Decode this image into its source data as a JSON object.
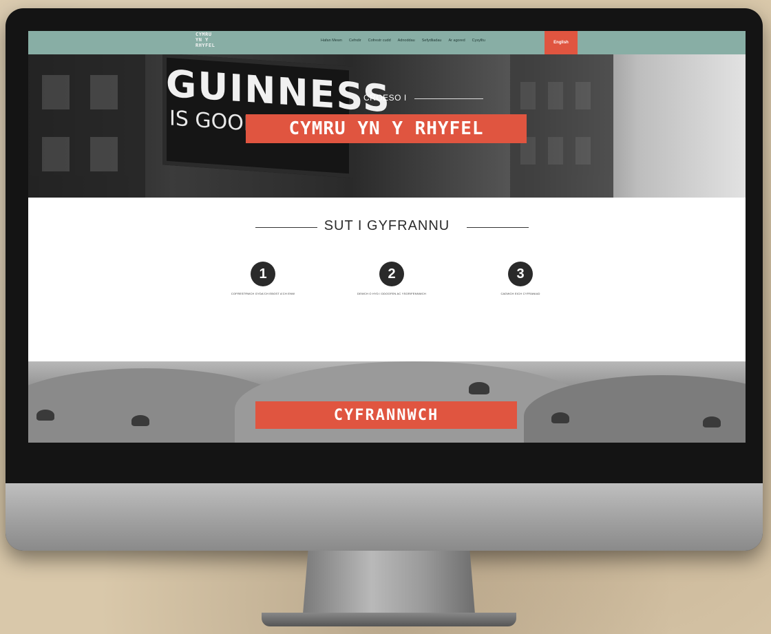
{
  "nav": {
    "logo_lines": [
      "CYMRU",
      "YN Y",
      "RHYFEL"
    ],
    "items": [
      "Hafan Mewn",
      "Cefndir",
      "Cofrestr cudd",
      "Adnoddau",
      "Sefydliadau",
      "Ar agored",
      "Cysylltu"
    ],
    "language_button": "English"
  },
  "hero": {
    "sign_text": "GUINNESS",
    "sign_sub": "IS GOOD",
    "pre_title": "CROESO I",
    "title": "CYMRU YN Y RHYFEL"
  },
  "how_to": {
    "title": "SUT I GYFRANNU",
    "steps": [
      {
        "number": "1",
        "text": "COFRESTRWCH GYDA'CH EBOST A'CH ENW"
      },
      {
        "number": "2",
        "text": "DEWCH O HYD I DDOGFEN AC YSGRIFENNWCH"
      },
      {
        "number": "3",
        "text": "CADWCH EICH CYFRANIAD"
      }
    ]
  },
  "banner": {
    "title": "CYFRANNWCH"
  },
  "colors": {
    "nav_bg": "#88aea5",
    "accent": "#e05540",
    "dark": "#2a2a2a"
  }
}
